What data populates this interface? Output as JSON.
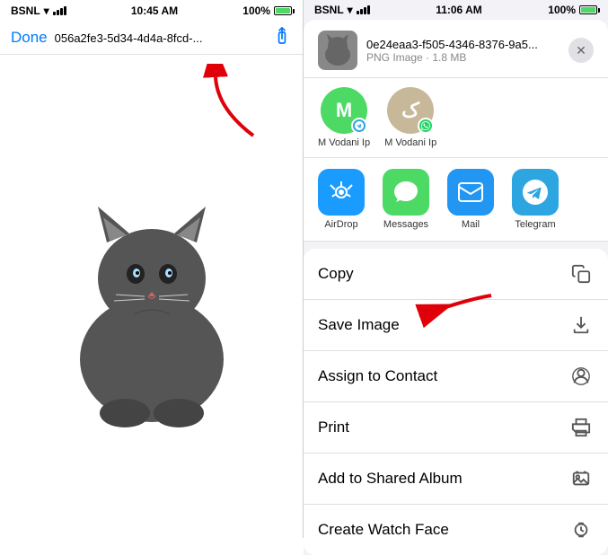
{
  "left": {
    "status": {
      "carrier": "BSNL",
      "time": "10:45 AM",
      "battery": "100%"
    },
    "nav": {
      "done_label": "Done",
      "file_name": "056a2fe3-5d34-4d4a-8fcd-..."
    },
    "image_alt": "Cat photo"
  },
  "right": {
    "status": {
      "carrier": "BSNL",
      "time": "11:06 AM",
      "battery": "100%"
    },
    "file": {
      "title": "0e24eaa3-f505-4346-8376-9a5...",
      "meta": "PNG Image · 1.8 MB"
    },
    "contacts": [
      {
        "initial": "M",
        "name": "M Vodani Ip",
        "badge": "telegram",
        "color": "green"
      },
      {
        "initial": "ک",
        "name": "M Vodani Ip",
        "badge": "whatsapp",
        "color": "beige"
      }
    ],
    "apps": [
      {
        "name": "AirDrop",
        "icon": "airdrop"
      },
      {
        "name": "Messages",
        "icon": "messages"
      },
      {
        "name": "Mail",
        "icon": "mail"
      },
      {
        "name": "Telegram",
        "icon": "telegram"
      }
    ],
    "actions": [
      {
        "label": "Copy",
        "icon": "copy"
      },
      {
        "label": "Save Image",
        "icon": "save"
      },
      {
        "label": "Assign to Contact",
        "icon": "contact"
      },
      {
        "label": "Print",
        "icon": "print"
      },
      {
        "label": "Add to Shared Album",
        "icon": "album"
      },
      {
        "label": "Create Watch Face",
        "icon": "watch"
      }
    ]
  }
}
